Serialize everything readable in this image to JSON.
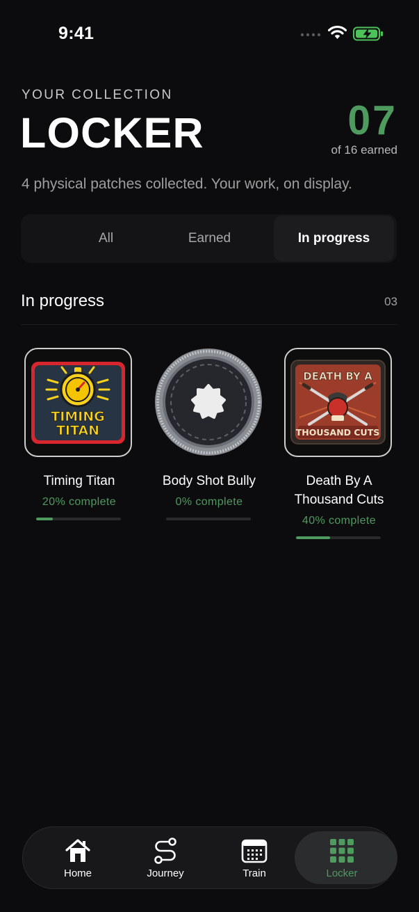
{
  "status_bar": {
    "time": "9:41"
  },
  "header": {
    "eyebrow": "YOUR COLLECTION",
    "title": "LOCKER",
    "earned_count": "07",
    "earned_caption": "of 16 earned",
    "subtitle": "4 physical patches collected. Your work, on display."
  },
  "filters": {
    "tabs": [
      {
        "label": "All",
        "active": false
      },
      {
        "label": "Earned",
        "active": false
      },
      {
        "label": "In progress",
        "active": true
      }
    ]
  },
  "section": {
    "title": "In progress",
    "count": "03"
  },
  "patches": [
    {
      "name": "Timing Titan",
      "progress_label": "20% complete",
      "progress": 0.2,
      "badge_text": [
        "TIMING",
        "TITAN"
      ]
    },
    {
      "name": "Body Shot Bully",
      "progress_label": "0% complete",
      "progress": 0.0
    },
    {
      "name": "Death By A Thousand Cuts",
      "progress_label": "40% complete",
      "progress": 0.4,
      "badge_text": [
        "DEATH BY A",
        "THOUSAND CUTS"
      ]
    }
  ],
  "tabbar": {
    "items": [
      {
        "label": "Home",
        "icon": "home-icon",
        "active": false
      },
      {
        "label": "Journey",
        "icon": "route-icon",
        "active": false
      },
      {
        "label": "Train",
        "icon": "calendar-icon",
        "active": false
      },
      {
        "label": "Locker",
        "icon": "grid-icon",
        "active": true
      }
    ]
  },
  "colors": {
    "accent": "#4f9a5f",
    "background": "#0c0c0e"
  }
}
